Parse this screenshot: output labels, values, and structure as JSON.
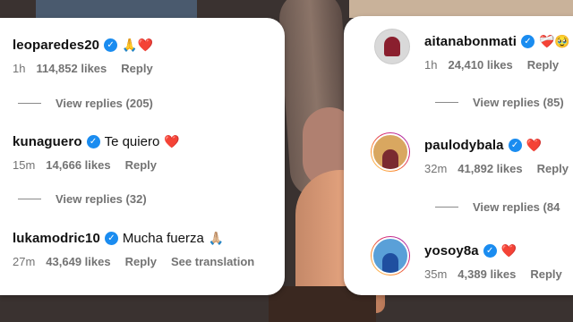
{
  "left_card": {
    "comments": [
      {
        "username": "leoparedes20",
        "text": "",
        "emoji": "🙏❤️",
        "time": "1h",
        "likes": "114,852 likes",
        "reply": "Reply",
        "view_replies": "View replies (205)"
      },
      {
        "username": "kunaguero",
        "text": "Te quiero",
        "emoji": "❤️",
        "time": "15m",
        "likes": "14,666 likes",
        "reply": "Reply",
        "view_replies": "View replies (32)"
      },
      {
        "username": "lukamodric10",
        "text": "Mucha fuerza",
        "emoji": "🙏🏼",
        "time": "27m",
        "likes": "43,649 likes",
        "reply": "Reply",
        "translation": "See translation"
      }
    ]
  },
  "right_card": {
    "comments": [
      {
        "username": "aitanabonmati",
        "text": "",
        "emoji": "❤️‍🩹🥹",
        "time": "1h",
        "likes": "24,410 likes",
        "reply": "Reply",
        "view_replies": "View replies (85)"
      },
      {
        "username": "paulodybala",
        "text": "",
        "emoji": "❤️",
        "time": "32m",
        "likes": "41,892 likes",
        "reply": "Reply",
        "view_replies": "View replies (84"
      },
      {
        "username": "yosoy8a",
        "text": "",
        "emoji": "❤️",
        "time": "35m",
        "likes": "4,389 likes",
        "reply": "Reply"
      }
    ]
  },
  "icons": {
    "verified": "verified-badge-icon"
  },
  "colors": {
    "verified_blue": "#1a8cf0",
    "meta_gray": "#737373",
    "heart_red": "#e0245e"
  }
}
